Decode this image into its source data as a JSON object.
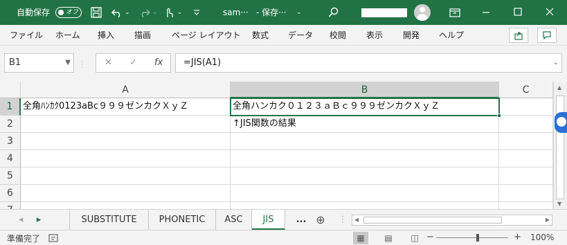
{
  "titlebar": {
    "autosave_label": "自動保存",
    "autosave_toggle": "オフ",
    "filename": "sam···",
    "save_status": "- 保存···",
    "dropdown_glyph": "⌄",
    "search_icon": "search-icon",
    "restore_icon": "ribbon-display-icon"
  },
  "menu": {
    "items": [
      "ファイル",
      "ホーム",
      "挿入",
      "描画",
      "ページ レイアウト",
      "数式",
      "データ",
      "校閲",
      "表示",
      "開発",
      "ヘルプ"
    ],
    "share_icon": "share-icon",
    "comment_icon": "comment-icon"
  },
  "formula_bar": {
    "name_box": "B1",
    "cancel_glyph": "✕",
    "enter_glyph": "✓",
    "fx_glyph": "fx",
    "formula": "=JIS(A1)"
  },
  "sheet": {
    "columns": [
      "A",
      "B",
      "C"
    ],
    "rows": [
      "1",
      "2",
      "3",
      "4",
      "5",
      "6",
      "7"
    ],
    "cells": {
      "A1": "全角ﾊﾝｶｸ0123aBc９９９ゼンカクＸｙＺ",
      "B1": "全角ハンカク０１２３ａＢｃ９９９ゼンカクＸｙＺ",
      "B2": "↑JIS関数の結果"
    }
  },
  "tabs": {
    "nav_prev": "◂",
    "nav_next": "▸",
    "items": [
      "SUBSTITUTE",
      "PHONETIC",
      "ASC",
      "JIS"
    ],
    "active": "JIS",
    "more": "...",
    "add": "⊕"
  },
  "status": {
    "ready": "準備完了",
    "zoom": "100%",
    "minus": "−",
    "plus": "+"
  },
  "colors": {
    "accent": "#217346",
    "floating": "#2b6fd6"
  }
}
